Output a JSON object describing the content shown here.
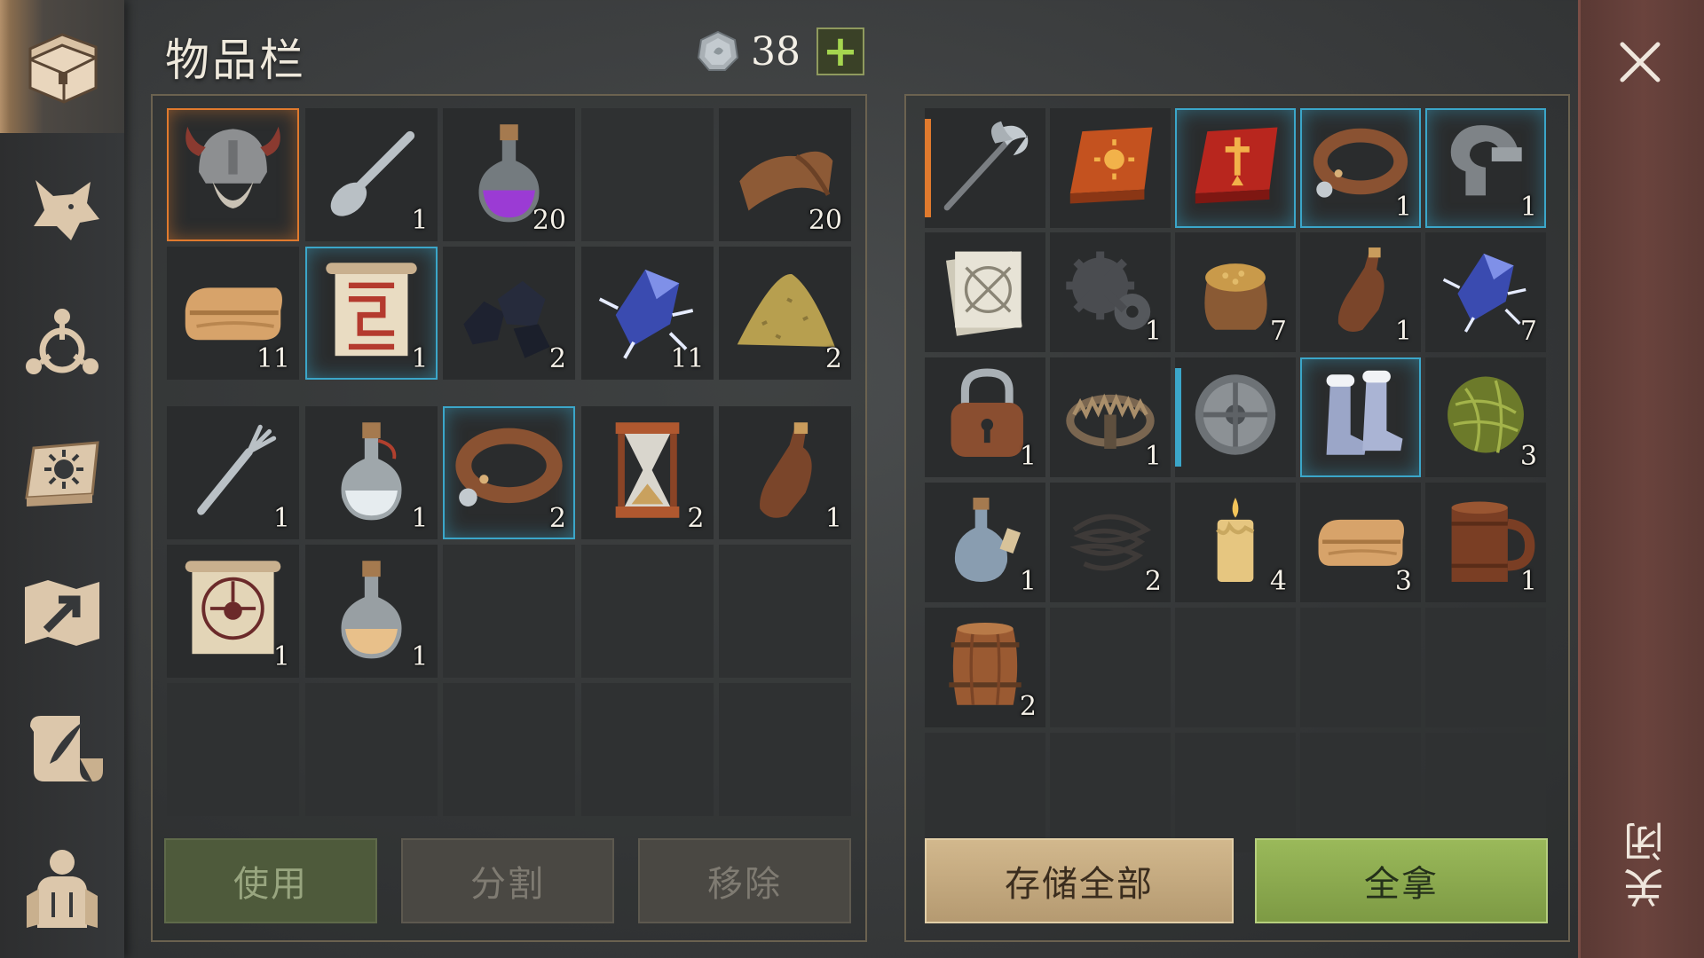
{
  "header": {
    "title": "物品栏",
    "currency_count": "38",
    "currency_icon": "silver-coin-icon",
    "add_icon": "plus-icon"
  },
  "sidebar": {
    "items": [
      {
        "icon": "chest-icon",
        "active": true
      },
      {
        "icon": "wolf-head-icon"
      },
      {
        "icon": "compass-rose-icon"
      },
      {
        "icon": "sun-book-icon"
      },
      {
        "icon": "map-arrow-icon"
      },
      {
        "icon": "quill-scroll-icon"
      },
      {
        "icon": "character-silhouette-icon"
      }
    ]
  },
  "inventory": {
    "slots": [
      {
        "item": "viking-helmet-icon",
        "qty": "",
        "state": "sel-orange"
      },
      {
        "item": "spoon-icon",
        "qty": "1"
      },
      {
        "item": "purple-potion-icon",
        "qty": "20"
      },
      {
        "item": "",
        "qty": ""
      },
      {
        "item": "leather-hide-icon",
        "qty": "20"
      },
      {
        "item": "folded-cloth-icon",
        "qty": "11"
      },
      {
        "item": "red-rune-scroll-icon",
        "qty": "1",
        "state": "sel-blue"
      },
      {
        "item": "coal-icon",
        "qty": "2"
      },
      {
        "item": "crystal-shard-icon",
        "qty": "11"
      },
      {
        "item": "sand-pile-icon",
        "qty": "2"
      },
      {
        "item": "fork-icon",
        "qty": "1"
      },
      {
        "item": "clear-potion-icon",
        "qty": "1"
      },
      {
        "item": "leather-collar-icon",
        "qty": "2",
        "state": "sel-blue"
      },
      {
        "item": "hourglass-icon",
        "qty": "2"
      },
      {
        "item": "leather-flask-icon",
        "qty": "1"
      },
      {
        "item": "skull-rune-scroll-icon",
        "qty": "1"
      },
      {
        "item": "amber-potion-icon",
        "qty": "1"
      },
      {
        "item": "",
        "qty": ""
      },
      {
        "item": "",
        "qty": ""
      },
      {
        "item": "",
        "qty": ""
      },
      {
        "item": "",
        "qty": ""
      },
      {
        "item": "",
        "qty": ""
      },
      {
        "item": "",
        "qty": ""
      },
      {
        "item": "",
        "qty": ""
      },
      {
        "item": "",
        "qty": ""
      }
    ],
    "buttons": {
      "use": "使用",
      "split": "分割",
      "remove": "移除"
    }
  },
  "container": {
    "slots": [
      {
        "item": "battle-axe-icon",
        "qty": "",
        "state": "bar-orange"
      },
      {
        "item": "sun-tome-icon",
        "qty": ""
      },
      {
        "item": "sword-tome-icon",
        "qty": "",
        "state": "sel-blue"
      },
      {
        "item": "leather-collar-icon",
        "qty": "1",
        "state": "sel-blue"
      },
      {
        "item": "iron-clamp-icon",
        "qty": "1",
        "state": "sel-blue"
      },
      {
        "item": "blueprint-papers-icon",
        "qty": ""
      },
      {
        "item": "gears-icon",
        "qty": "1"
      },
      {
        "item": "grain-sack-icon",
        "qty": "7"
      },
      {
        "item": "leather-flask-icon",
        "qty": "1"
      },
      {
        "item": "crystal-shard-icon",
        "qty": "7"
      },
      {
        "item": "padlock-icon",
        "qty": "1"
      },
      {
        "item": "bear-trap-icon",
        "qty": "1"
      },
      {
        "item": "round-shield-icon",
        "qty": "",
        "state": "bar-blue"
      },
      {
        "item": "fur-boots-icon",
        "qty": "",
        "state": "sel-blue"
      },
      {
        "item": "herb-ball-icon",
        "qty": "3"
      },
      {
        "item": "water-flask-icon",
        "qty": "1"
      },
      {
        "item": "wire-coil-icon",
        "qty": "2"
      },
      {
        "item": "candle-icon",
        "qty": "4"
      },
      {
        "item": "folded-cloth-icon",
        "qty": "3"
      },
      {
        "item": "wooden-mug-icon",
        "qty": "1"
      },
      {
        "item": "barrel-icon",
        "qty": "2"
      },
      {
        "item": "",
        "qty": ""
      },
      {
        "item": "",
        "qty": ""
      },
      {
        "item": "",
        "qty": ""
      },
      {
        "item": "",
        "qty": ""
      },
      {
        "item": "",
        "qty": ""
      },
      {
        "item": "",
        "qty": ""
      },
      {
        "item": "",
        "qty": ""
      },
      {
        "item": "",
        "qty": ""
      },
      {
        "item": "",
        "qty": ""
      }
    ],
    "buttons": {
      "store_all": "存储全部",
      "take_all": "全拿"
    }
  },
  "close": {
    "label": "关闭",
    "icon": "close-x-icon"
  },
  "colors": {
    "select_blue": "#3ba6c9",
    "select_orange": "#e07a2e",
    "take_all_green": "#8eae50",
    "store_all_tan": "#c8ad82"
  }
}
